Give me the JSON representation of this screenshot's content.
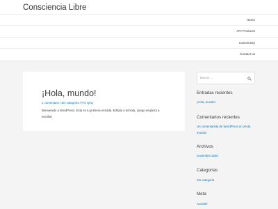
{
  "site": {
    "title": "Consciencia Libre"
  },
  "nav": {
    "items": [
      {
        "label": "Home"
      },
      {
        "label": "API Products"
      },
      {
        "label": "Community"
      },
      {
        "label": "Contact us"
      }
    ]
  },
  "post": {
    "title": "¡Hola, mundo!",
    "meta": "1 comentario / Sin categoría / Por Qrsy",
    "excerpt": "Bienvenido a WordPress. Esta es tu primera entrada. Edítala o bórrala, ¡luego empieza a escribir!"
  },
  "sidebar": {
    "search": {
      "placeholder": "Buscar ..."
    },
    "recent_posts": {
      "title": "Entradas recientes",
      "items": [
        "¡Hola, mundo!"
      ]
    },
    "recent_comments": {
      "title": "Comentarios recientes",
      "text": "Un comentarista de WordPress en ¡Hola, mundo!"
    },
    "archives": {
      "title": "Archivos",
      "items": [
        "noviembre 2020"
      ]
    },
    "categories": {
      "title": "Categorías",
      "items": [
        "Sin categoría"
      ]
    },
    "meta": {
      "title": "Meta",
      "items": [
        "Acceder"
      ]
    }
  },
  "colors": {
    "link": "#0274be",
    "background": "#f4f4f4",
    "header": "#ffffff"
  }
}
